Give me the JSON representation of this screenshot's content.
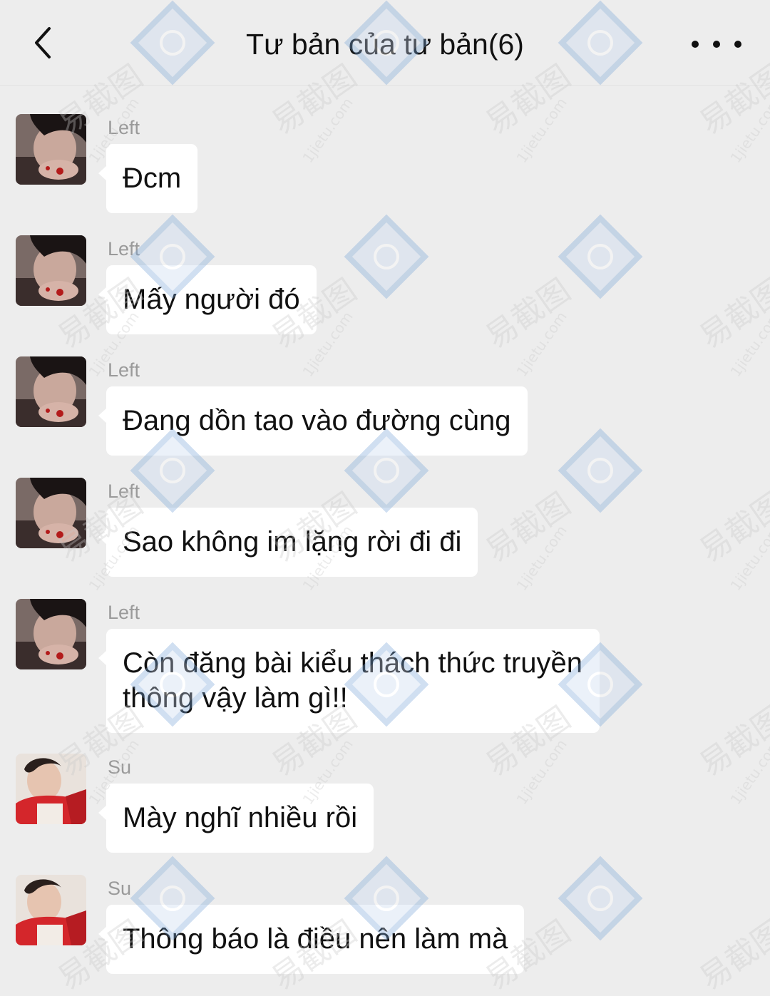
{
  "header": {
    "title": "Tư bản của tư bản(6)",
    "back_icon": "chevron-left-icon",
    "more_icon": "more-horizontal-icon"
  },
  "messages": [
    {
      "sender": "Left",
      "text": "Đcm",
      "avatar": "avatar-left"
    },
    {
      "sender": "Left",
      "text": "Mấy người đó",
      "avatar": "avatar-left"
    },
    {
      "sender": "Left",
      "text": "Đang dồn tao vào đường cùng",
      "avatar": "avatar-left"
    },
    {
      "sender": "Left",
      "text": "Sao không im lặng rời đi đi",
      "avatar": "avatar-left"
    },
    {
      "sender": "Left",
      "text": "Còn đăng bài kiểu thách thức truyền thông vậy làm gì!!",
      "avatar": "avatar-left"
    },
    {
      "sender": "Su",
      "text": "Mày nghĩ nhiều rồi",
      "avatar": "avatar-su"
    },
    {
      "sender": "Su",
      "text": "Thông báo là điều nên làm mà",
      "avatar": "avatar-su"
    }
  ],
  "watermark": {
    "text": "易截图",
    "url": "1jietu.com"
  },
  "colors": {
    "background": "#ededed",
    "bubble": "#ffffff",
    "sender": "#9a9a9a",
    "text": "#111111"
  }
}
